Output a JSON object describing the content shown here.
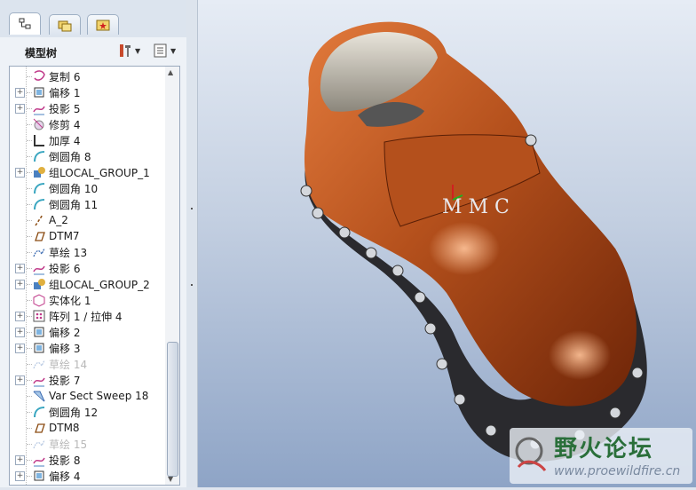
{
  "tabs": [
    {
      "name": "model-tree-tab",
      "icon": "tree-structure-icon",
      "active": true
    },
    {
      "name": "folder-browser-tab",
      "icon": "folders-icon",
      "active": false
    },
    {
      "name": "favorites-tab",
      "icon": "star-folder-icon",
      "active": false
    }
  ],
  "panel": {
    "title": "模型树"
  },
  "tree_items": [
    {
      "label": "复制 6",
      "icon": "copy-feature-icon",
      "expandable": false,
      "dim": false
    },
    {
      "label": "偏移 1",
      "icon": "offset-feature-icon",
      "expandable": true,
      "dim": false
    },
    {
      "label": "投影 5",
      "icon": "projection-feature-icon",
      "expandable": true,
      "dim": false
    },
    {
      "label": "修剪 4",
      "icon": "trim-feature-icon",
      "expandable": false,
      "dim": false
    },
    {
      "label": "加厚 4",
      "icon": "thicken-feature-icon",
      "expandable": false,
      "dim": false
    },
    {
      "label": "倒圆角 8",
      "icon": "round-feature-icon",
      "expandable": false,
      "dim": false
    },
    {
      "label": "组LOCAL_GROUP_1",
      "icon": "group-feature-icon",
      "expandable": true,
      "dim": false
    },
    {
      "label": "倒圆角 10",
      "icon": "round-feature-icon",
      "expandable": false,
      "dim": false
    },
    {
      "label": "倒圆角 11",
      "icon": "round-feature-icon",
      "expandable": false,
      "dim": false
    },
    {
      "label": "A_2",
      "icon": "datum-axis-icon",
      "expandable": false,
      "dim": false
    },
    {
      "label": "DTM7",
      "icon": "datum-plane-icon",
      "expandable": false,
      "dim": false
    },
    {
      "label": "草绘 13",
      "icon": "sketch-feature-icon",
      "expandable": false,
      "dim": false
    },
    {
      "label": "投影 6",
      "icon": "projection-feature-icon",
      "expandable": true,
      "dim": false
    },
    {
      "label": "组LOCAL_GROUP_2",
      "icon": "group-feature-icon",
      "expandable": true,
      "dim": false
    },
    {
      "label": "实体化 1",
      "icon": "solidify-feature-icon",
      "expandable": false,
      "dim": false
    },
    {
      "label": "阵列 1 / 拉伸 4",
      "icon": "pattern-feature-icon",
      "expandable": true,
      "dim": false
    },
    {
      "label": "偏移 2",
      "icon": "offset-feature-icon",
      "expandable": true,
      "dim": false
    },
    {
      "label": "偏移 3",
      "icon": "offset-feature-icon",
      "expandable": true,
      "dim": false
    },
    {
      "label": "草绘 14",
      "icon": "sketch-feature-icon",
      "expandable": false,
      "dim": true
    },
    {
      "label": "投影 7",
      "icon": "projection-feature-icon",
      "expandable": true,
      "dim": false
    },
    {
      "label": "Var Sect Sweep 18",
      "icon": "sweep-feature-icon",
      "expandable": false,
      "dim": false
    },
    {
      "label": "倒圆角 12",
      "icon": "round-feature-icon",
      "expandable": false,
      "dim": false
    },
    {
      "label": "DTM8",
      "icon": "datum-plane-icon",
      "expandable": false,
      "dim": false
    },
    {
      "label": "草绘 15",
      "icon": "sketch-feature-icon",
      "expandable": false,
      "dim": true
    },
    {
      "label": "投影 8",
      "icon": "projection-feature-icon",
      "expandable": true,
      "dim": false
    },
    {
      "label": "偏移 4",
      "icon": "offset-feature-icon",
      "expandable": true,
      "dim": false
    }
  ],
  "model_text": "M M C",
  "watermark": {
    "title": "野火论坛",
    "subtitle": "www.proewildfire.cn"
  },
  "colors": {
    "shoe": "#b4501c",
    "sole": "#2a2a2e",
    "accent": "#2a6f3a"
  }
}
